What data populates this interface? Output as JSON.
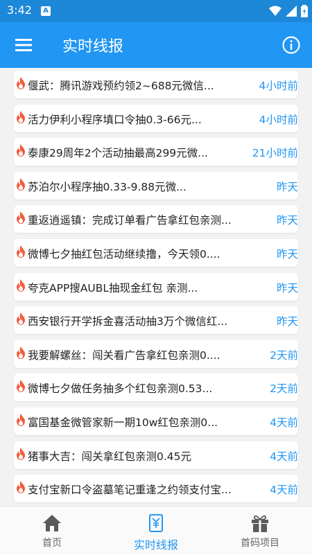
{
  "status_bar": {
    "time": "3:42",
    "notification_icon": "A"
  },
  "app_bar": {
    "title": "实时线报"
  },
  "list": [
    {
      "text": "偃武：腾讯游戏预约领2~688元微信...",
      "time": "4小时前"
    },
    {
      "text": "活力伊利小程序填口令抽0.3-66元...",
      "time": "4小时前"
    },
    {
      "text": "泰康29周年2个活动抽最高299元微...",
      "time": "21小时前"
    },
    {
      "text": "苏泊尔小程序抽0.33-9.88元微...",
      "time": "昨天"
    },
    {
      "text": "重返逍遥镇：完成订单看广告拿红包亲测...",
      "time": "昨天"
    },
    {
      "text": "微博七夕抽红包活动继续撸，今天领0....",
      "time": "昨天"
    },
    {
      "text": "夸克APP搜AUBL抽现金红包 亲测...",
      "time": "昨天"
    },
    {
      "text": "西安银行开学拆金喜活动抽3万个微信红...",
      "time": "昨天"
    },
    {
      "text": "我要解螺丝：闯关看广告拿红包亲测0....",
      "time": "2天前"
    },
    {
      "text": "微博七夕做任务抽多个红包亲测0.53...",
      "time": "2天前"
    },
    {
      "text": "富国基金微管家新一期10w红包亲测0...",
      "time": "4天前"
    },
    {
      "text": "猪事大吉：闯关拿红包亲测0.45元",
      "time": "4天前"
    },
    {
      "text": "支付宝新口令盗墓笔记重逢之约领支付宝...",
      "time": "4天前"
    }
  ],
  "bottom_nav": {
    "home": "首页",
    "news": "实时线报",
    "projects": "首码项目"
  },
  "colors": {
    "primary": "#2196f3",
    "status_bar": "#1e88d8",
    "fire": "#f25c3c"
  }
}
